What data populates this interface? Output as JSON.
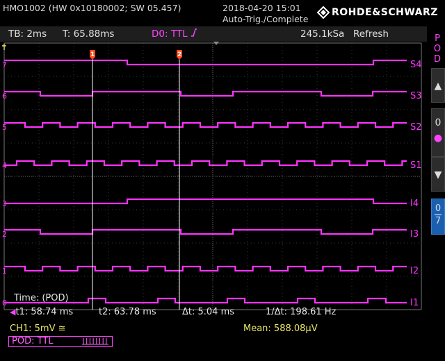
{
  "header": {
    "device": "HMO1002 (HW 0x10180002; SW 05.457)",
    "datetime": "2018-04-20 15:01",
    "status": "Auto-Trig./Complete",
    "brand": "ROHDE&SCHWARZ"
  },
  "toolbar": {
    "timebase": "TB: 2ms",
    "trigger_time": "T: 65.88ms",
    "trigger_source": "D0: TTL",
    "sample_rate": "245.1kSa",
    "mode": "Refresh"
  },
  "side_panel": {
    "pod_label": "POD",
    "digit_zero": "0",
    "range_label_top": "0",
    "range_label_bottom": "7"
  },
  "channels": {
    "right_labels": [
      "S4",
      "S3",
      "S2",
      "S1",
      "I4",
      "I3",
      "I2",
      "I1"
    ],
    "left_labels": [
      "7",
      "6",
      "5",
      "4",
      "3",
      "2",
      "1",
      "0"
    ],
    "color": "#ff33ff"
  },
  "cursors": {
    "c1_label": "1",
    "c2_label": "2",
    "t1": "t1: 58.74 ms",
    "t2": "t2: 63.78 ms",
    "dt": "Δt: 5.04 ms",
    "inv_dt": "1/Δt: 198.61 Hz",
    "marker_color": "#ff4a1a"
  },
  "time_readout": "Time: (POD)",
  "footer": {
    "ch1": "CH1: 5mV",
    "ch1_coupling": "≅",
    "mean": "Mean: 588.08µV",
    "pod": "POD: TTL"
  }
}
